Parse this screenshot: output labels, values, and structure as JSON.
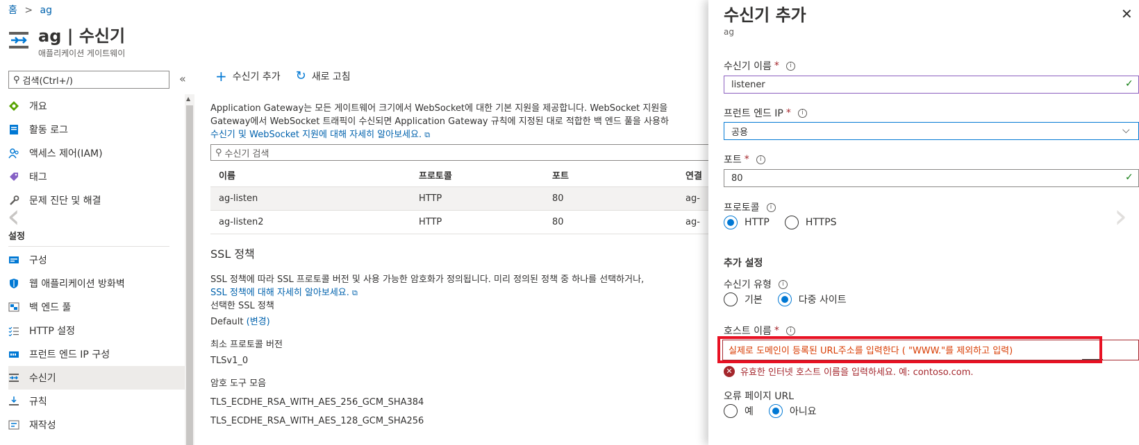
{
  "breadcrumb": {
    "home": "홈",
    "separator": ">",
    "current": "ag"
  },
  "resource": {
    "title": "ag | 수신기",
    "subtitle": "애플리케이션 게이트웨이"
  },
  "sidebar": {
    "search_placeholder": "검색(Ctrl+/)",
    "collapse": "«",
    "items_top": [
      {
        "label": "개요",
        "icon": "overview-icon"
      },
      {
        "label": "활동 로그",
        "icon": "activity-log-icon"
      },
      {
        "label": "액세스 제어(IAM)",
        "icon": "iam-icon"
      },
      {
        "label": "태그",
        "icon": "tag-icon"
      },
      {
        "label": "문제 진단 및 해결",
        "icon": "wrench-icon"
      }
    ],
    "settings_heading": "설정",
    "items_settings": [
      {
        "label": "구성",
        "icon": "config-icon"
      },
      {
        "label": "웹 애플리케이션 방화벽",
        "icon": "shield-icon"
      },
      {
        "label": "백 엔드 풀",
        "icon": "backend-pool-icon"
      },
      {
        "label": "HTTP 설정",
        "icon": "http-settings-icon"
      },
      {
        "label": "프런트 엔드 IP 구성",
        "icon": "frontend-ip-icon"
      },
      {
        "label": "수신기",
        "icon": "listener-icon",
        "active": true
      },
      {
        "label": "규칙",
        "icon": "rules-icon"
      },
      {
        "label": "재작성",
        "icon": "rewrite-icon"
      }
    ]
  },
  "toolbar": {
    "add_label": "수신기 추가",
    "refresh_label": "새로 고침"
  },
  "main": {
    "desc_line1": "Application Gateway는 모든 게이트웨어 크기에서 WebSocket에 대한 기본 지원을 제공합니다. WebSocket 지원을",
    "desc_line2": "Gateway에서 WebSocket 트래픽이 수신되면 Application Gateway 규칙에 지정된 대로 적합한 백 엔드 풀을 사용하",
    "desc_link": "수신기 및 WebSocket 지원에 대해 자세히 알아보세요.",
    "table_search_placeholder": "수신기 검색",
    "columns": [
      "이름",
      "프로토콜",
      "포트",
      "연결"
    ],
    "rows": [
      {
        "name": "ag-listen",
        "protocol": "HTTP",
        "port": "80",
        "assoc": "ag-"
      },
      {
        "name": "ag-listen2",
        "protocol": "HTTP",
        "port": "80",
        "assoc": "ag-"
      }
    ],
    "ssl_title": "SSL 정책",
    "ssl_desc": "SSL 정책에 따라 SSL 프로토콜 버전 및 사용 가능한 암호화가 정의됩니다. 미리 정의된 정책 중 하나를 선택하거나,",
    "ssl_link": "SSL 정책에 대해 자세히 알아보세요.",
    "selected_policy_label": "선택한 SSL 정책",
    "selected_policy_value": "Default",
    "change_label": "(변경)",
    "min_protocol_label": "최소 프로토콜 버전",
    "min_protocol_value": "TLSv1_0",
    "cipher_label": "암호 도구 모음",
    "ciphers": [
      "TLS_ECDHE_RSA_WITH_AES_256_GCM_SHA384",
      "TLS_ECDHE_RSA_WITH_AES_128_GCM_SHA256"
    ]
  },
  "panel": {
    "title": "수신기 추가",
    "subtitle": "ag",
    "name_label": "수신기 이름",
    "name_value": "listener",
    "frontend_label": "프런트 엔드 IP",
    "frontend_value": "공용",
    "port_label": "포트",
    "port_value": "80",
    "protocol_label": "프로토콜",
    "protocol_options": [
      "HTTP",
      "HTTPS"
    ],
    "protocol_selected": "HTTP",
    "additional_heading": "추가 설정",
    "listener_type_label": "수신기 유형",
    "listener_type_options": [
      "기본",
      "다중 사이트"
    ],
    "listener_type_selected": "다중 사이트",
    "host_label": "호스트 이름",
    "host_value": "실제로 도메인이 등록된 URL주소를 입력한다 ( \"WWW.\"를 제외하고 입력)",
    "host_error": "유효한 인터넷 호스트 이름을 입력하세요. 예: contoso.com.",
    "error_page_label": "오류 페이지 URL",
    "error_page_options": [
      "예",
      "아니요"
    ],
    "error_page_selected": "아니요",
    "required_mark": "*"
  },
  "colors": {
    "accent": "#0078d4",
    "link": "#0062ad",
    "error": "#a4262c",
    "highlight_box": "#e81123",
    "check": "#107c10"
  }
}
